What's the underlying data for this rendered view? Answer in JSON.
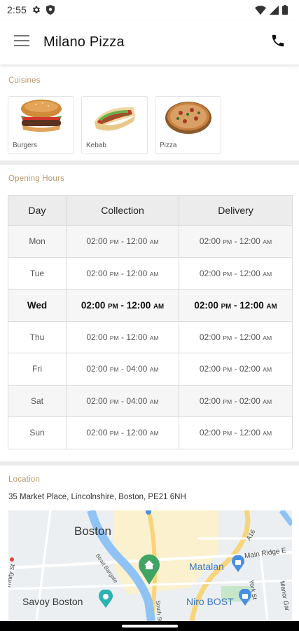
{
  "status_bar": {
    "time": "2:55"
  },
  "app_bar": {
    "title": "Milano Pizza"
  },
  "cuisines": {
    "label": "Cuisines",
    "items": [
      {
        "name": "Burgers",
        "icon": "burger-image"
      },
      {
        "name": "Kebab",
        "icon": "kebab-image"
      },
      {
        "name": "Pizza",
        "icon": "pizza-image"
      }
    ]
  },
  "opening_hours": {
    "label": "Opening Hours",
    "headers": {
      "day": "Day",
      "collection": "Collection",
      "delivery": "Delivery"
    },
    "rows": [
      {
        "day": "Mon",
        "collection_start": "02:00",
        "collection_start_ampm": "PM",
        "collection_end": "12:00",
        "collection_end_ampm": "AM",
        "delivery_start": "02:00",
        "delivery_start_ampm": "PM",
        "delivery_end": "12:00",
        "delivery_end_ampm": "AM"
      },
      {
        "day": "Tue",
        "collection_start": "02:00",
        "collection_start_ampm": "PM",
        "collection_end": "12:00",
        "collection_end_ampm": "AM",
        "delivery_start": "02:00",
        "delivery_start_ampm": "PM",
        "delivery_end": "12:00",
        "delivery_end_ampm": "AM"
      },
      {
        "day": "Wed",
        "collection_start": "02:00",
        "collection_start_ampm": "PM",
        "collection_end": "12:00",
        "collection_end_ampm": "AM",
        "delivery_start": "02:00",
        "delivery_start_ampm": "PM",
        "delivery_end": "12:00",
        "delivery_end_ampm": "AM"
      },
      {
        "day": "Thu",
        "collection_start": "02:00",
        "collection_start_ampm": "PM",
        "collection_end": "12:00",
        "collection_end_ampm": "AM",
        "delivery_start": "02:00",
        "delivery_start_ampm": "PM",
        "delivery_end": "12:00",
        "delivery_end_ampm": "AM"
      },
      {
        "day": "Fri",
        "collection_start": "02:00",
        "collection_start_ampm": "PM",
        "collection_end": "04:00",
        "collection_end_ampm": "AM",
        "delivery_start": "02:00",
        "delivery_start_ampm": "PM",
        "delivery_end": "02:00",
        "delivery_end_ampm": "AM"
      },
      {
        "day": "Sat",
        "collection_start": "02:00",
        "collection_start_ampm": "PM",
        "collection_end": "04:00",
        "collection_end_ampm": "AM",
        "delivery_start": "02:00",
        "delivery_start_ampm": "PM",
        "delivery_end": "02:00",
        "delivery_end_ampm": "AM"
      },
      {
        "day": "Sun",
        "collection_start": "02:00",
        "collection_start_ampm": "PM",
        "collection_end": "12:00",
        "collection_end_ampm": "AM",
        "delivery_start": "02:00",
        "delivery_start_ampm": "PM",
        "delivery_end": "12:00",
        "delivery_end_ampm": "AM"
      }
    ],
    "today": "Wed"
  },
  "location": {
    "label": "Location",
    "address": "35 Market Place, Lincolnshire, Boston, PE21 6NH",
    "map": {
      "labels": {
        "city": "Boston",
        "matalan": "Matalan",
        "main_ridge": "Main Ridge E",
        "savoy": "Savoy Boston",
        "niro": "Niro BOST",
        "trinity": "Trinity St",
        "a16": "A16",
        "york": "York St",
        "manor": "Manor Gar",
        "strait": "Strait Bargate",
        "south": "South St"
      }
    }
  },
  "colors": {
    "section_label": "#b89a6e",
    "map_water": "#8fc3f5",
    "map_road": "#f7d57a",
    "map_park": "#c8e6c9",
    "pin_green": "#3fa464",
    "pin_blue": "#4a90e2"
  }
}
